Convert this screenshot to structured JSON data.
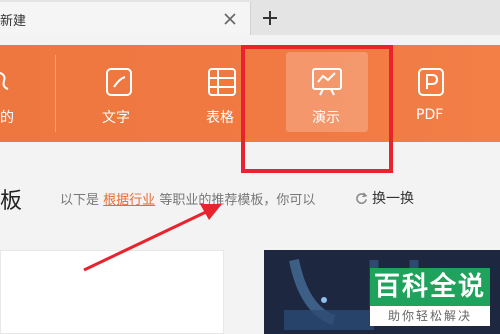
{
  "tab": {
    "title": "新建"
  },
  "toolbar": {
    "items": [
      {
        "label": "文字"
      },
      {
        "label": "表格"
      },
      {
        "label": "演示"
      },
      {
        "label": "PDF"
      }
    ],
    "partial_label": "的"
  },
  "recommend": {
    "title": "板",
    "hint_prefix": "以下是",
    "hint_link": "根据行业",
    "hint_suffix": "等职业的推荐模板，你可以",
    "refresh_label": "换一换"
  },
  "watermark": {
    "top": "百科全说",
    "bottom": "助你轻松解决"
  },
  "colors": {
    "toolbar": "#f17a43",
    "annotation": "#e8232d",
    "link": "#e86a35",
    "watermark": "#1fa35c"
  }
}
